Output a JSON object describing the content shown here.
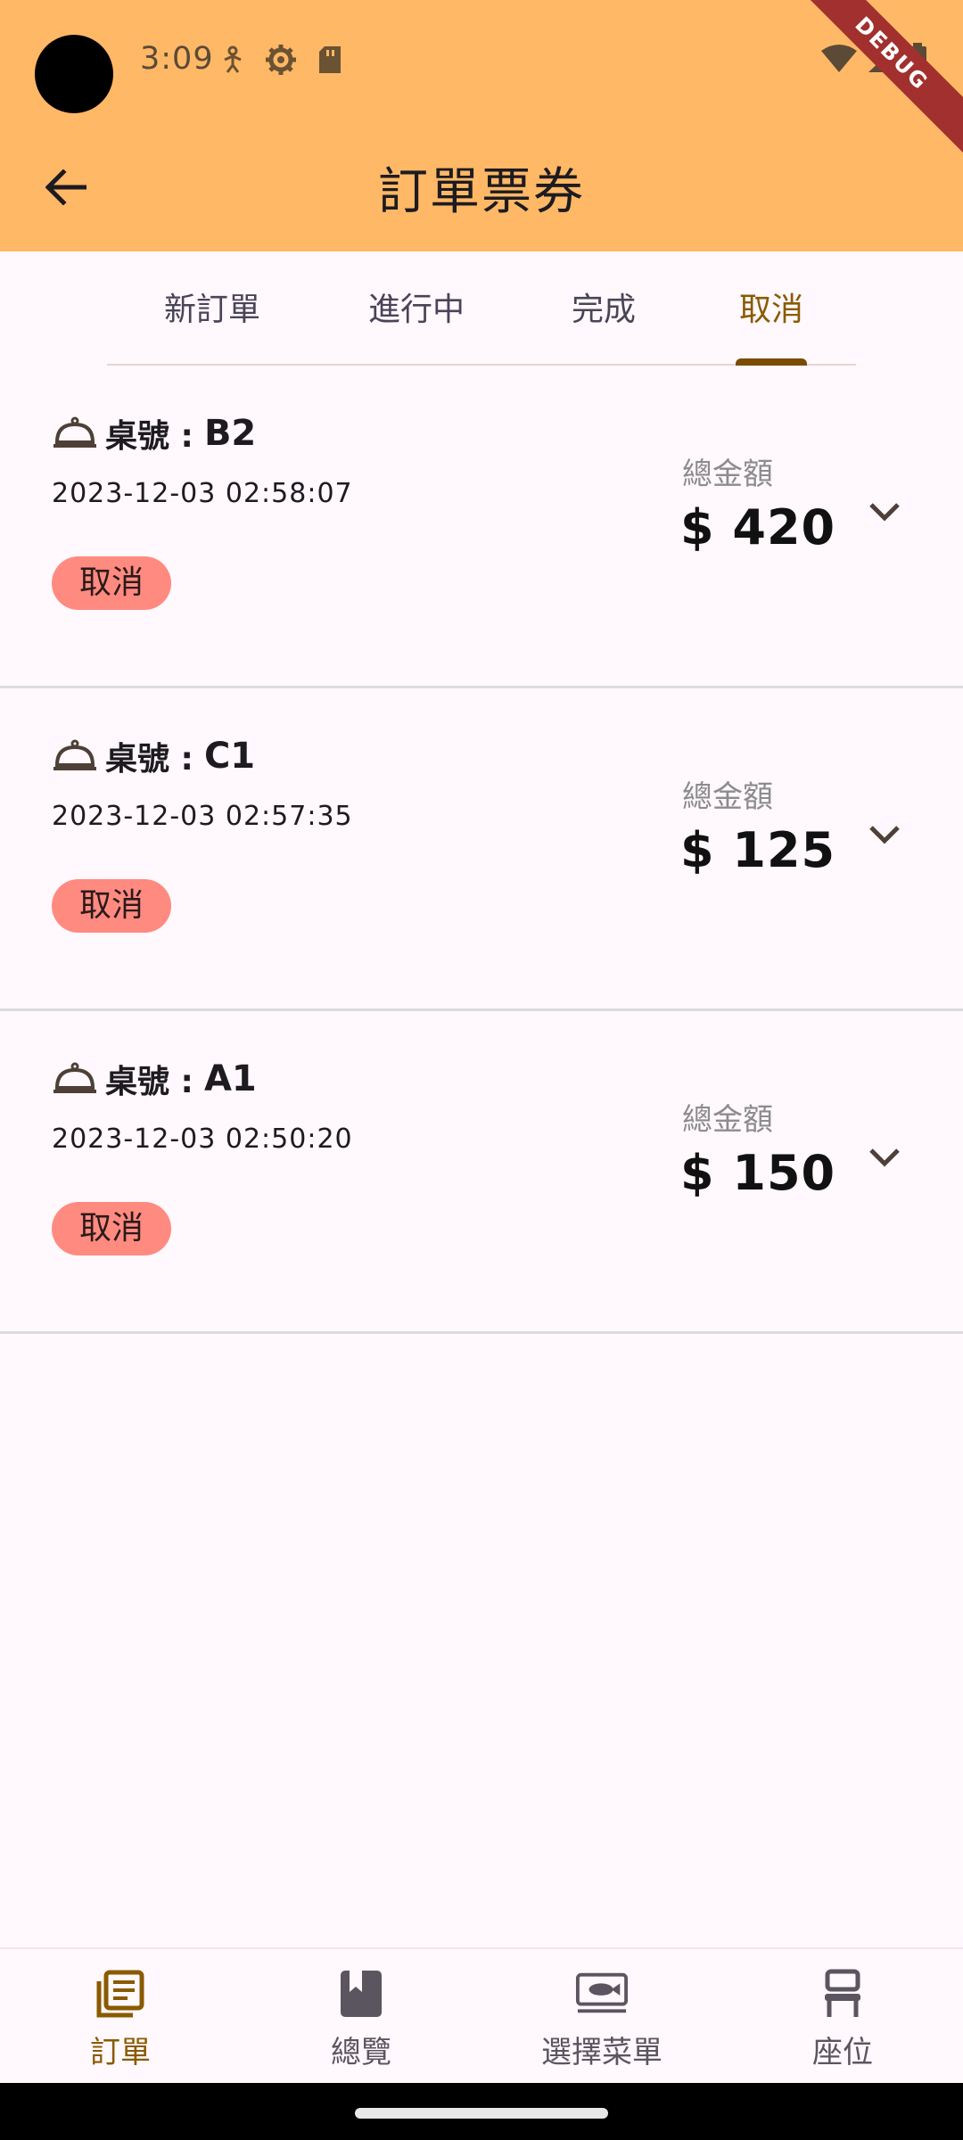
{
  "status_bar": {
    "time": "3:09"
  },
  "debug_ribbon": "DEBUG",
  "appbar": {
    "title": "訂單票券"
  },
  "tabs": [
    {
      "label": "新訂單",
      "active": false
    },
    {
      "label": "進行中",
      "active": false
    },
    {
      "label": "完成",
      "active": false
    },
    {
      "label": "取消",
      "active": true
    }
  ],
  "orders": [
    {
      "table_label": "桌號 :",
      "table_no": "B2",
      "time": "2023-12-03 02:58:07",
      "status": "取消",
      "amount_label": "總金額",
      "amount": "$ 420"
    },
    {
      "table_label": "桌號 :",
      "table_no": "C1",
      "time": "2023-12-03 02:57:35",
      "status": "取消",
      "amount_label": "總金額",
      "amount": "$ 125"
    },
    {
      "table_label": "桌號 :",
      "table_no": "A1",
      "time": "2023-12-03 02:50:20",
      "status": "取消",
      "amount_label": "總金額",
      "amount": "$ 150"
    }
  ],
  "bottom_nav": [
    {
      "label": "訂單",
      "icon": "orders-icon",
      "active": true
    },
    {
      "label": "總覽",
      "icon": "bookmark-book-icon",
      "active": false
    },
    {
      "label": "選擇菜單",
      "icon": "menu-dish-icon",
      "active": false
    },
    {
      "label": "座位",
      "icon": "seat-icon",
      "active": false
    }
  ],
  "colors": {
    "header_bg": "#FFB866",
    "accent": "#8A5A00",
    "chip_bg": "#FF8A80",
    "page_bg": "#FFF8FD"
  }
}
